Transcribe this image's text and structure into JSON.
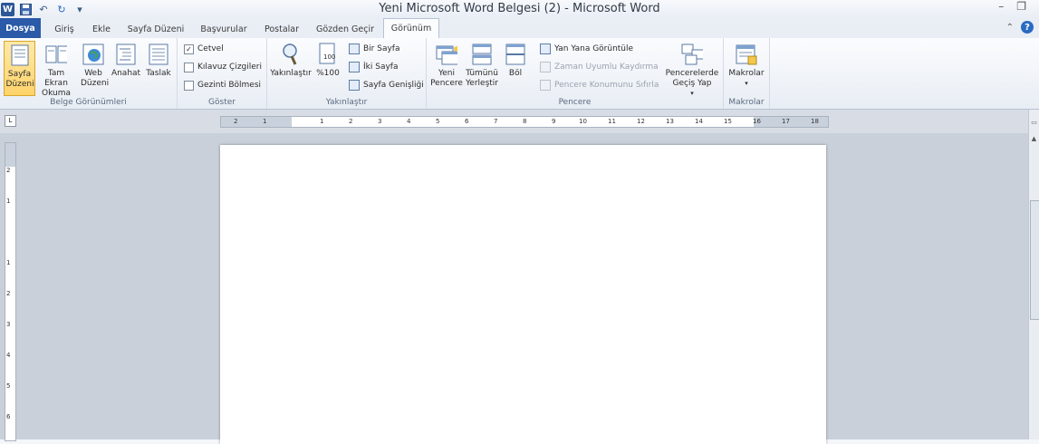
{
  "window": {
    "title": "Yeni Microsoft Word Belgesi (2) - Microsoft Word",
    "app_icon": "W",
    "controls": {
      "minimize": "–",
      "restore": "❐"
    }
  },
  "qat": {
    "save_icon": "save-icon",
    "undo_icon": "undo-icon",
    "redo_icon": "redo-icon",
    "customize_icon": "customize-icon"
  },
  "tabs": {
    "file": "Dosya",
    "items": [
      "Giriş",
      "Ekle",
      "Sayfa Düzeni",
      "Başvurular",
      "Postalar",
      "Gözden Geçir",
      "Görünüm"
    ],
    "active": "Görünüm"
  },
  "ribbon": {
    "belge_gorunumleri": {
      "label": "Belge Görünümleri",
      "buttons": [
        "Sayfa Düzeni",
        "Tam Ekran Okuma",
        "Web Düzeni",
        "Anahat",
        "Taslak"
      ]
    },
    "goster": {
      "label": "Göster",
      "items": [
        {
          "label": "Cetvel",
          "checked": true
        },
        {
          "label": "Kılavuz Çizgileri",
          "checked": false
        },
        {
          "label": "Gezinti Bölmesi",
          "checked": false
        }
      ]
    },
    "yakinlastir": {
      "label": "Yakınlaştır",
      "buttons": [
        "Yakınlaştır",
        "%100"
      ],
      "small": [
        "Bir Sayfa",
        "İki Sayfa",
        "Sayfa Genişliği"
      ]
    },
    "pencere": {
      "label": "Pencere",
      "buttons": [
        "Yeni Pencere",
        "Tümünü Yerleştir",
        "Böl"
      ],
      "small": [
        "Yan Yana Görüntüle",
        "Zaman Uyumlu Kaydırma",
        "Pencere Konumunu Sıfırla"
      ],
      "switch": "Pencerelerde Geçiş Yap"
    },
    "makrolar": {
      "label": "Makrolar",
      "button": "Makrolar"
    }
  },
  "ruler": {
    "h_numbers": [
      "2",
      "1",
      "1",
      "2",
      "3",
      "4",
      "5",
      "6",
      "7",
      "8",
      "9",
      "10",
      "11",
      "12",
      "13",
      "14",
      "15",
      "16",
      "17",
      "18"
    ],
    "v_numbers": [
      "2",
      "1",
      "1",
      "2",
      "3",
      "4",
      "5",
      "6"
    ],
    "tab_selector": "L"
  }
}
